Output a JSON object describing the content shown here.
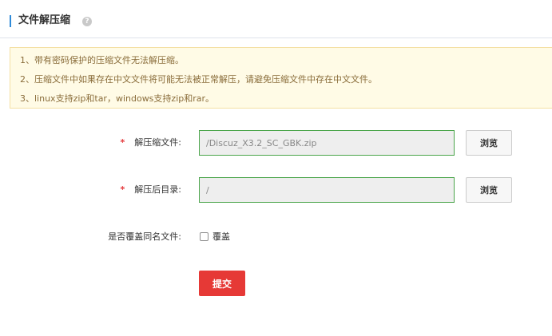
{
  "header": {
    "title": "文件解压缩",
    "help_icon": "?"
  },
  "notice": {
    "lines": [
      "1、带有密码保护的压缩文件无法解压缩。",
      "2、压缩文件中如果存在中文文件将可能无法被正常解压，请避免压缩文件中存在中文文件。",
      "3、linux支持zip和tar，windows支持zip和rar。"
    ]
  },
  "form": {
    "required_mark": "*",
    "file": {
      "label": "解压缩文件:",
      "value": "/Discuz_X3.2_SC_GBK.zip",
      "browse_label": "浏览"
    },
    "target": {
      "label": "解压后目录:",
      "value": "/",
      "browse_label": "浏览"
    },
    "overwrite": {
      "label": "是否覆盖同名文件:",
      "checkbox_label": "覆盖",
      "checked": false
    },
    "submit_label": "提交"
  },
  "colors": {
    "accent": "#2f8ad8",
    "notice_bg": "#fffbe6",
    "notice_text": "#8a6d3b",
    "input_border": "#4aa54a",
    "submit_bg": "#e63936",
    "required": "#e4393c"
  }
}
